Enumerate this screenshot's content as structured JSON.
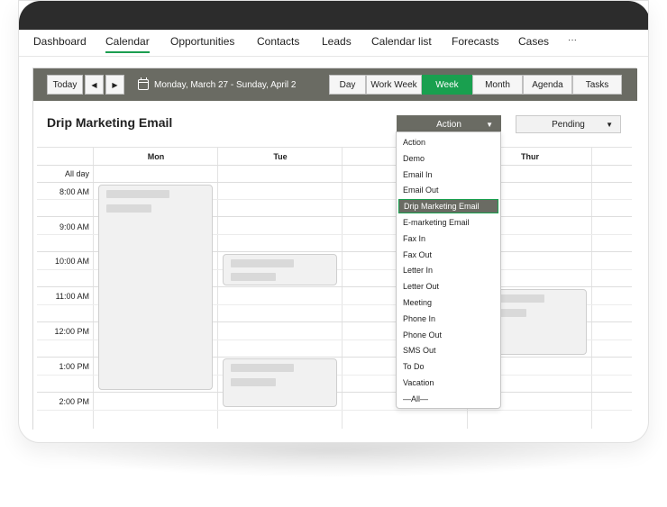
{
  "nav": {
    "items": [
      {
        "label": "Dashboard"
      },
      {
        "label": "Calendar"
      },
      {
        "label": "Opportunities"
      },
      {
        "label": "Contacts"
      },
      {
        "label": "Leads"
      },
      {
        "label": "Calendar list"
      },
      {
        "label": "Forecasts"
      },
      {
        "label": "Cases"
      },
      {
        "label": "···"
      }
    ],
    "active": "Calendar"
  },
  "toolbar": {
    "today_label": "Today",
    "prev_icon": "◀",
    "next_icon": "▶",
    "date_range": "Monday, March 27 - Sunday, April 2",
    "views": [
      {
        "label": "Day"
      },
      {
        "label": "Work Week"
      },
      {
        "label": "Week"
      },
      {
        "label": "Month"
      },
      {
        "label": "Agenda"
      },
      {
        "label": "Tasks"
      }
    ],
    "active_view": "Week"
  },
  "calendar": {
    "title": "Drip Marketing Email",
    "activity_filter": "Action",
    "status_filter": "Pending",
    "filter_arrow": "▼",
    "days": [
      "Mon",
      "Tue",
      "",
      "Thur"
    ],
    "all_day_label": "All day",
    "times": [
      "8:00 AM",
      "9:00 AM",
      "10:00 AM",
      "11:00 AM",
      "12:00 PM",
      "1:00 PM",
      "2:00 PM"
    ]
  },
  "dropdown": {
    "options": [
      "Action",
      "Demo",
      "Email In",
      "Email Out",
      "Drip Marketing Email",
      "E-marketing Email",
      "Fax In",
      "Fax Out",
      "Letter In",
      "Letter Out",
      "Meeting",
      "Phone In",
      "Phone Out",
      "SMS Out",
      "To Do",
      "Vacation",
      "—All—"
    ],
    "selected": "Drip Marketing Email"
  },
  "colors": {
    "accent": "#19a04f",
    "toolbar": "#6a6b63",
    "device_top": "#2c2c2c"
  }
}
